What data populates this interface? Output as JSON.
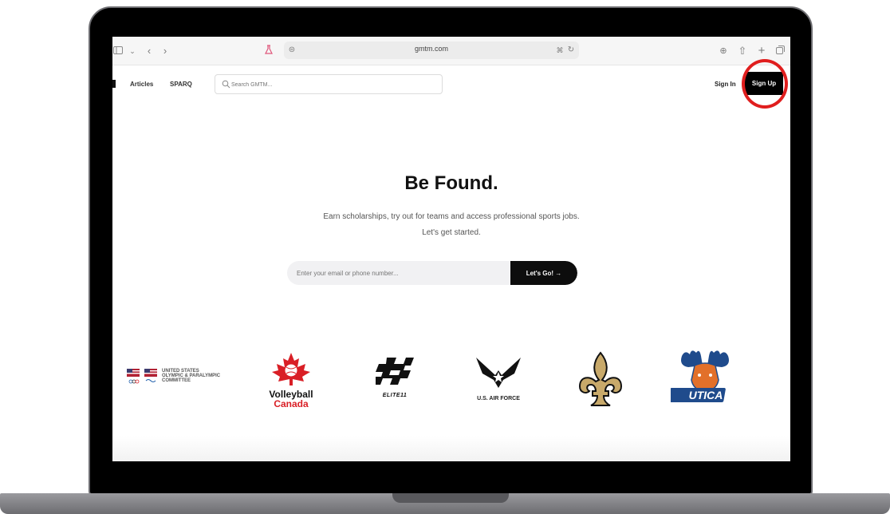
{
  "browser": {
    "url": "gmtm.com"
  },
  "nav": {
    "links": [
      "Articles",
      "SPARQ"
    ],
    "search_placeholder": "Search GMTM...",
    "sign_in": "Sign In",
    "sign_up": "Sign Up"
  },
  "hero": {
    "title": "Be Found.",
    "subtitle_line1": "Earn scholarships, try out for teams and access professional sports jobs.",
    "subtitle_line2": "Let's get started.",
    "email_placeholder": "Enter your email or phone number...",
    "cta_label": "Let's Go! →"
  },
  "partners": {
    "usopc": [
      "UNITED STATES",
      "OLYMPIC & PARALYMPIC",
      "COMMITTEE"
    ],
    "volleyball_canada": [
      "Volleyball",
      "Canada"
    ],
    "elite11": "ELITE11",
    "air_force": "U.S. AIR FORCE",
    "saints": "fleur-de-lis",
    "utica": "UTICA"
  },
  "colors": {
    "highlight_circle": "#e01e1e",
    "sign_up_bg": "#000000",
    "cta_bg": "#0d0d0d",
    "canada_red": "#d91f26",
    "elite_yellow": "#f2c200",
    "saints_gold": "#c8a96a",
    "utica_orange": "#e2702a",
    "utica_blue": "#1f4b8c"
  }
}
